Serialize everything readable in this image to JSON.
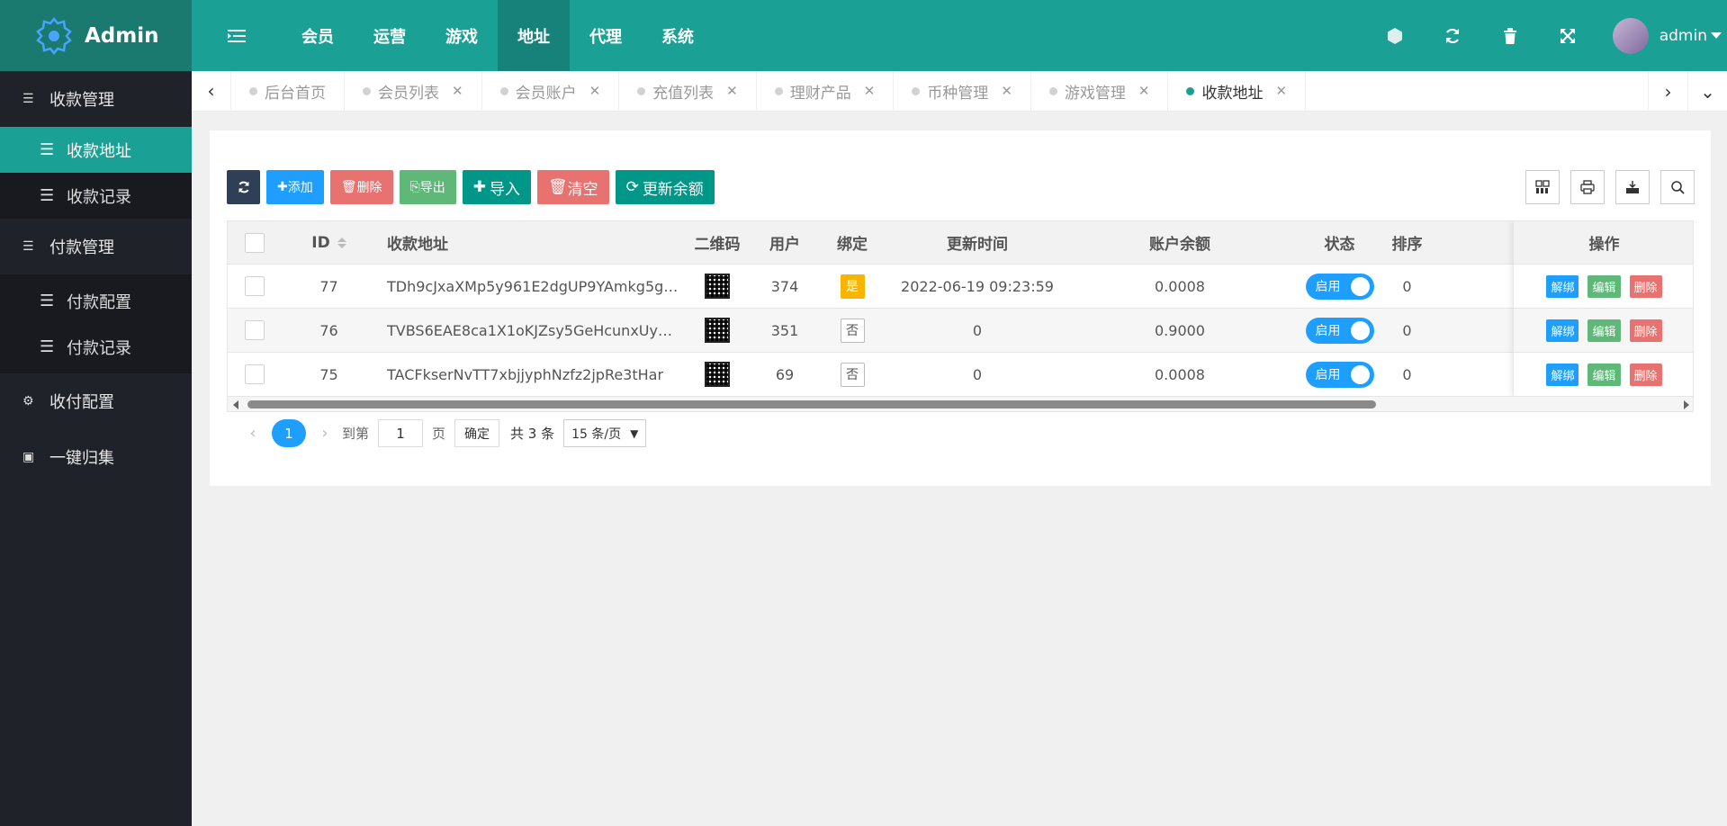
{
  "app": {
    "title": "Admin",
    "user": "admin"
  },
  "header": {
    "nav": [
      "会员",
      "运营",
      "游戏",
      "地址",
      "代理",
      "系统"
    ],
    "active_nav": "地址"
  },
  "sidebar": {
    "groups": [
      {
        "label": "收款管理",
        "items": [
          "收款地址",
          "收款记录"
        ]
      },
      {
        "label": "付款管理",
        "items": [
          "付款配置",
          "付款记录"
        ]
      },
      {
        "label": "收付配置",
        "items": []
      },
      {
        "label": "一键归集",
        "items": []
      }
    ],
    "active_item": "收款地址"
  },
  "tabs": [
    "后台首页",
    "会员列表",
    "会员账户",
    "充值列表",
    "理财产品",
    "币种管理",
    "游戏管理",
    "收款地址"
  ],
  "toolbar": {
    "add": "添加",
    "delete": "删除",
    "export": "导出",
    "import": "导入",
    "clear": "清空",
    "update_balance": "更新余额"
  },
  "table": {
    "columns": [
      "ID",
      "收款地址",
      "二维码",
      "用户",
      "绑定",
      "更新时间",
      "账户余额",
      "状态",
      "排序",
      "操作"
    ],
    "rows": [
      {
        "id": "77",
        "address": "TDh9cJxaXMp5y961E2dgUP9YAmkg5g…",
        "user": "374",
        "bind": "是",
        "time": "2022-06-19 09:23:59",
        "balance": "0.0008",
        "status": "启用",
        "sort": "0"
      },
      {
        "id": "76",
        "address": "TVBS6EAE8ca1X1oKJZsy5GeHcunxUy…",
        "user": "351",
        "bind": "否",
        "time": "0",
        "balance": "0.9000",
        "status": "启用",
        "sort": "0"
      },
      {
        "id": "75",
        "address": "TACFkserNvTT7xbjjyphNzfz2jpRe3tHar",
        "user": "69",
        "bind": "否",
        "time": "0",
        "balance": "0.0008",
        "status": "启用",
        "sort": "0"
      }
    ],
    "ops": {
      "unbind": "解绑",
      "edit": "编辑",
      "delete": "删除"
    }
  },
  "pager": {
    "current": "1",
    "goto_label": "到第",
    "goto_value": "1",
    "page_label": "页",
    "confirm": "确定",
    "total": "共 3 条",
    "page_size": "15 条/页"
  },
  "colors": {
    "brand": "#1aa094",
    "sidebar": "#20222a",
    "blue": "#1e9fff",
    "red": "#e8726f",
    "green": "#5fb878",
    "teal": "#009688",
    "yellow": "#f7b500"
  }
}
